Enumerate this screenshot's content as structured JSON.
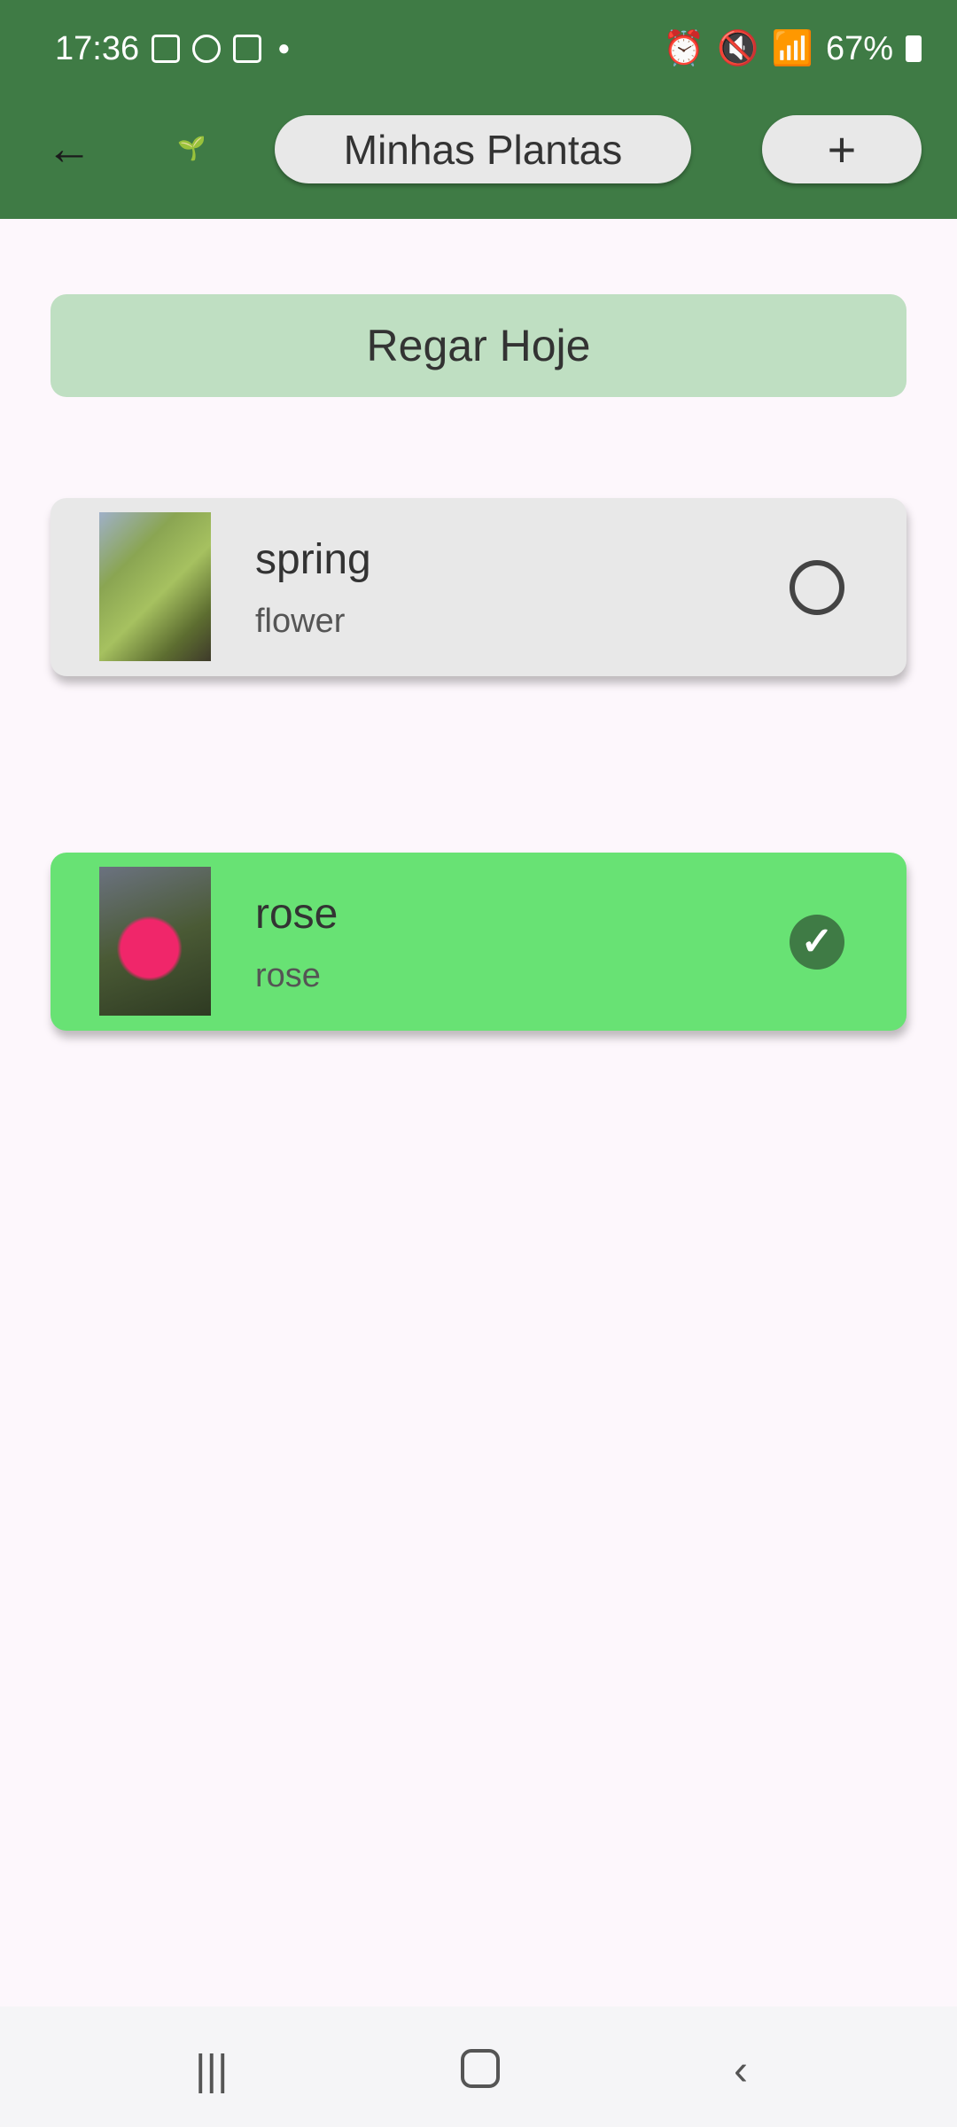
{
  "status_bar": {
    "time": "17:36",
    "battery": "67%"
  },
  "app_bar": {
    "title": "Minhas Plantas",
    "add_label": "+",
    "back_icon": "arrow-left-icon",
    "logo": "plant-in-hand-logo"
  },
  "water_today_label": "Regar Hoje",
  "plants": [
    {
      "name": "spring",
      "type": "flower",
      "watered": false,
      "color": "#e8e8e8"
    },
    {
      "name": "rose",
      "type": "rose",
      "watered": true,
      "color": "#68e274"
    }
  ],
  "colors": {
    "primary": "#3f7b45",
    "button": "#bfdfc2"
  }
}
